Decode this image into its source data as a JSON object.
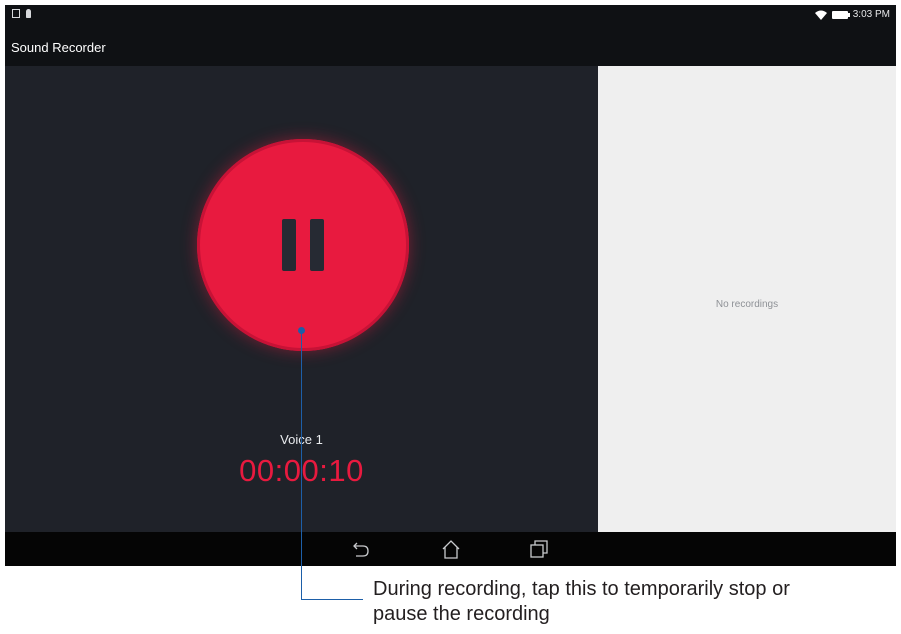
{
  "status_bar": {
    "clock": "3:03 PM",
    "icons": [
      "sim-icon",
      "mic-icon",
      "wifi-icon",
      "battery-icon"
    ]
  },
  "app_bar": {
    "title": "Sound Recorder"
  },
  "recorder": {
    "button_icon": "pause-icon",
    "voice_name": "Voice 1",
    "timer": "00:00:10",
    "accent_color": "#e81a3f"
  },
  "recordings_panel": {
    "empty_text": "No recordings"
  },
  "nav_bar": {
    "icons": [
      "back-icon",
      "home-icon",
      "recent-apps-icon"
    ]
  },
  "callout": {
    "text_line1": "During recording, tap this to temporarily stop or",
    "text_line2": "pause the recording",
    "color": "#1d5fa8"
  }
}
